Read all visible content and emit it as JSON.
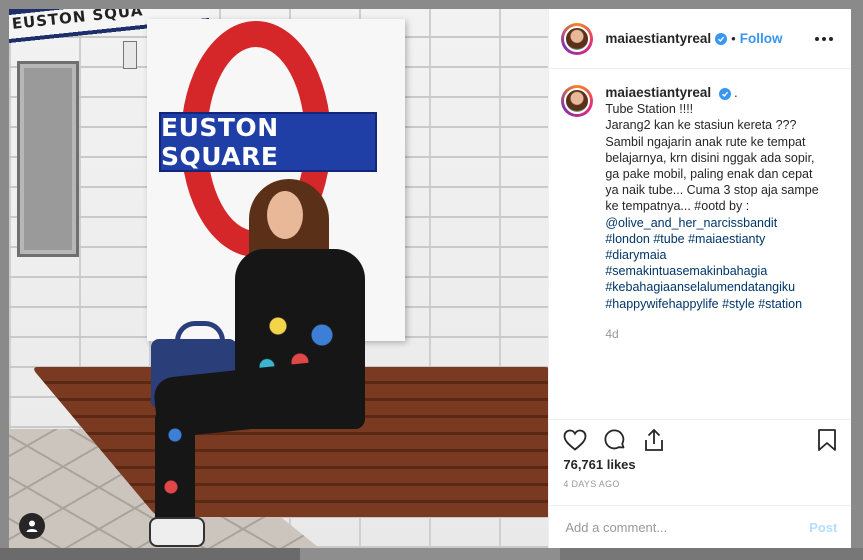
{
  "photo": {
    "sign_text": "EUSTON SQUARE",
    "top_strip_text": "EUSTON SQUA"
  },
  "header": {
    "username": "maiaestiantyreal",
    "separator": "•",
    "follow_label": "Follow"
  },
  "caption": {
    "username": "maiaestiantyreal",
    "dot": ".",
    "text": "Tube Station !!!!\nJarang2 kan ke stasiun kereta ???\nSambil ngajarin anak rute ke tempat belajarnya, krn disini nggak ada sopir, ga pake mobil, paling enak dan cepat ya naik tube... Cuma 3 stop aja sampe ke tempatnya... #ootd by :",
    "tags": "@olive_and_her_narcissbandit\n#london #tube #maiaestianty\n#diarymaia\n#semakintuasemakinbahagia\n#kebahagiaanselalumendatangiku\n#happywifehappylife #style #station",
    "time": "4d"
  },
  "stats": {
    "likes": "76,761 likes",
    "date": "4 DAYS AGO"
  },
  "comment": {
    "placeholder": "Add a comment...",
    "post_label": "Post"
  },
  "colors": {
    "accent": "#3897f0",
    "tag_link": "#003569",
    "roundel_red": "#d5262a",
    "roundel_blue": "#1f3fa6"
  }
}
